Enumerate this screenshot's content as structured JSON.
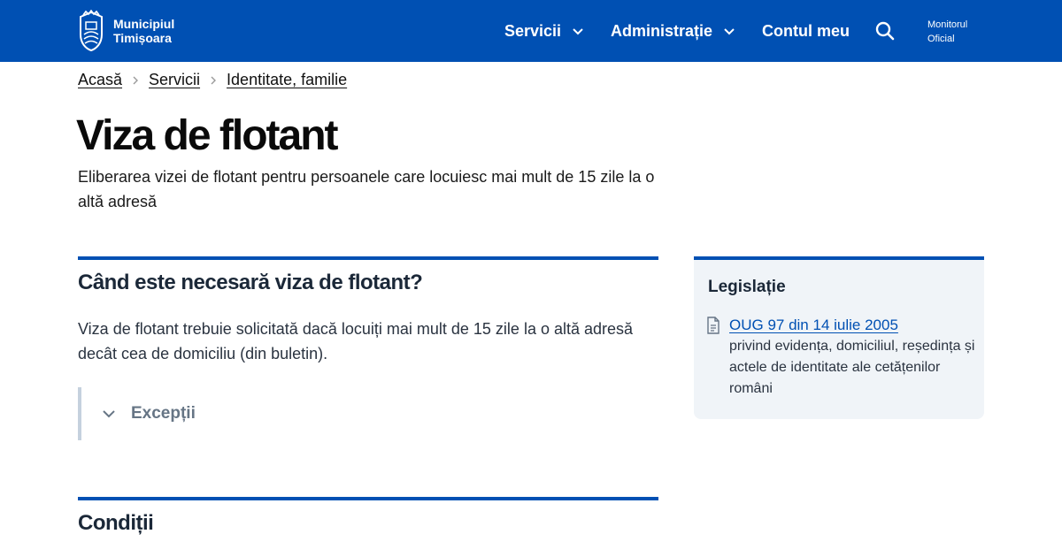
{
  "header": {
    "logo_line1": "Municipiul",
    "logo_line2": "Timișoara",
    "nav": {
      "servicii": "Servicii",
      "administratie": "Administrație",
      "cont": "Contul meu"
    },
    "monitor_line1": "Monitorul",
    "monitor_line2": "Oficial",
    "colors": {
      "background": "#0050b3",
      "text": "#ffffff"
    }
  },
  "breadcrumb": [
    "Acasă",
    "Servicii",
    "Identitate, familie"
  ],
  "page": {
    "title": "Viza de flotant",
    "lead": "Eliberarea vizei de flotant pentru persoanele care locuiesc mai mult de 15 zile la o altă adresă"
  },
  "main": {
    "section1_title": "Când este necesară viza de flotant?",
    "section1_text": "Viza de flotant trebuie solicitată dacă locuiți mai mult de 15 zile la o altă adresă decât cea de domiciliu (din buletin).",
    "accordion_label": "Excepții",
    "section2_title": "Condiții"
  },
  "aside": {
    "title": "Legislație",
    "law_link": "OUG 97 din 14 iulie 2005",
    "law_desc": "privind evidența, domiciliul, reședința și actele de identitate ale cetățenilor români"
  },
  "icons": {
    "logo": "city-crest-icon",
    "nav_dropdown": "chevron-down-icon",
    "search": "search-icon",
    "breadcrumb_sep": "chevron-right-icon",
    "accordion": "chevron-down-icon",
    "document": "document-icon"
  },
  "colors": {
    "accent": "#0050b3",
    "aside_bg": "#f0f4f8",
    "muted": "#667585"
  }
}
